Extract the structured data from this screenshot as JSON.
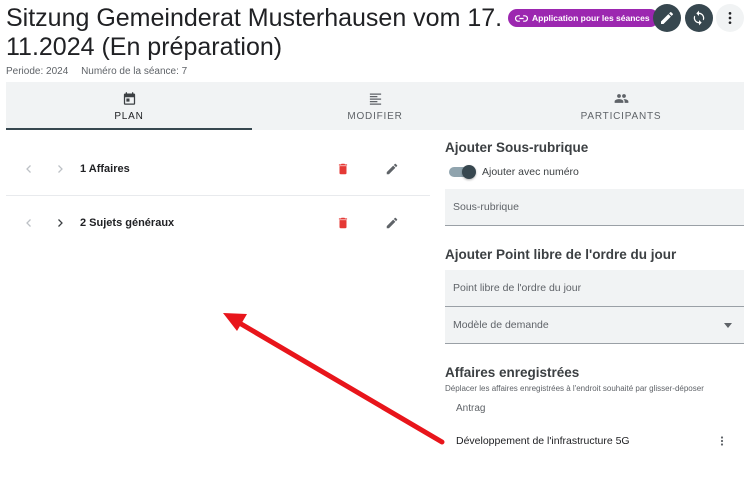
{
  "header": {
    "title": "Sitzung Gemeinderat Musterhausen vom 17.11.2024 (En préparation)",
    "period": "Periode: 2024",
    "session_number": "Numéro de la séance: 7",
    "app_chip": "Application pour les séances"
  },
  "tabs": [
    {
      "label": "PLAN",
      "icon": "calendar-icon",
      "active": true
    },
    {
      "label": "MODIFIER",
      "icon": "text-lines-icon",
      "active": false
    },
    {
      "label": "PARTICIPANTS",
      "icon": "people-icon",
      "active": false
    }
  ],
  "plan": {
    "items": [
      {
        "label": "1 Affaires"
      },
      {
        "label": "2 Sujets généraux"
      }
    ]
  },
  "right": {
    "sub_heading": "Ajouter Sous-rubrique",
    "toggle_label": "Ajouter avec numéro",
    "sub_placeholder": "Sous-rubrique",
    "free_heading": "Ajouter Point libre de l'ordre du jour",
    "free_placeholder": "Point libre de l'ordre du jour",
    "template_select": "Modèle de demande",
    "saved_heading": "Affaires enregistrées",
    "saved_hint": "Déplacer les affaires enregistrées à l'endroit souhaité par glisser-déposer",
    "saved_items": [
      {
        "label": "Antrag"
      },
      {
        "label": "Développement de l'infrastructure 5G"
      }
    ]
  },
  "colors": {
    "chip": "#9c27b0",
    "dark_button": "#37474f",
    "delete": "#e53935",
    "annotation_arrow": "#e8151b"
  }
}
